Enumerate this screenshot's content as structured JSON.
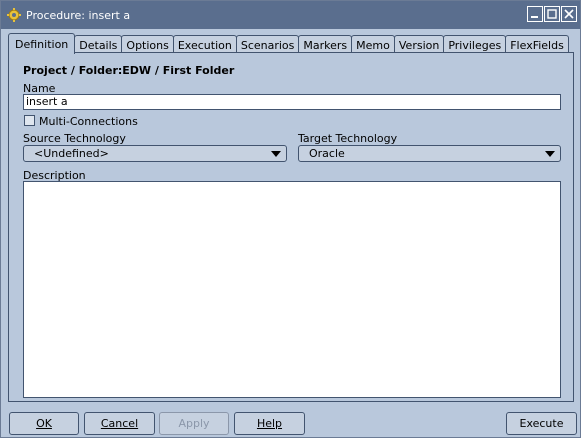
{
  "window": {
    "title": "Procedure: insert a",
    "app_icon": "gear-icon",
    "controls": [
      "minimize-icon",
      "maximize-icon",
      "close-icon"
    ]
  },
  "tabs": [
    {
      "label": "Definition",
      "active": true
    },
    {
      "label": "Details",
      "active": false
    },
    {
      "label": "Options",
      "active": false
    },
    {
      "label": "Execution",
      "active": false
    },
    {
      "label": "Scenarios",
      "active": false
    },
    {
      "label": "Markers",
      "active": false
    },
    {
      "label": "Memo",
      "active": false
    },
    {
      "label": "Version",
      "active": false
    },
    {
      "label": "Privileges",
      "active": false
    },
    {
      "label": "FlexFields",
      "active": false
    }
  ],
  "form": {
    "heading": "Project / Folder:EDW / First Folder",
    "name_label": "Name",
    "name_value": "insert a",
    "multi_connections_label": "Multi-Connections",
    "multi_connections_checked": false,
    "source_label": "Source Technology",
    "source_value": "<Undefined>",
    "target_label": "Target Technology",
    "target_value": "Oracle",
    "description_label": "Description",
    "description_value": ""
  },
  "buttons": {
    "ok": "OK",
    "cancel": "Cancel",
    "apply": "Apply",
    "help": "Help",
    "execute": "Execute"
  },
  "colors": {
    "background": "#b9c8dc",
    "titlebar": "#5a6e8e",
    "border": "#42546f"
  }
}
